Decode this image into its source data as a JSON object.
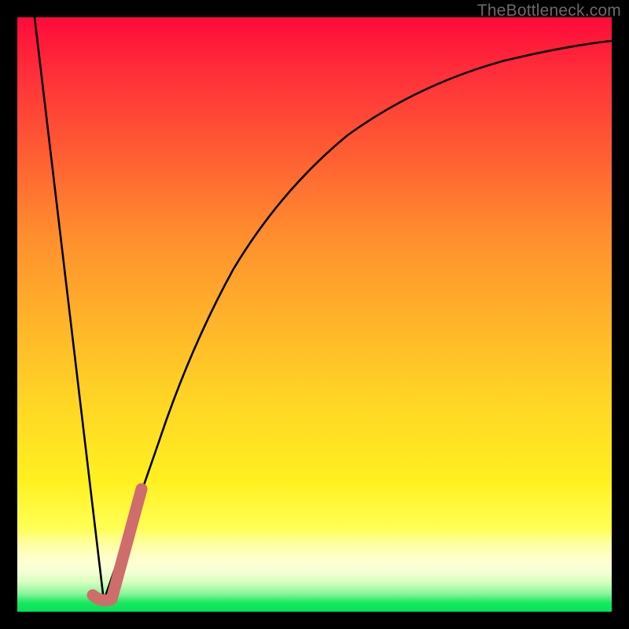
{
  "watermark": {
    "text": "TheBottleneck.com"
  },
  "chart_data": {
    "type": "line",
    "title": "",
    "xlabel": "",
    "ylabel": "",
    "xlim": [
      0,
      100
    ],
    "ylim": [
      0,
      100
    ],
    "grid": false,
    "legend": false,
    "series": [
      {
        "name": "left-descent",
        "stroke": "#000000",
        "values_xy": [
          [
            3,
            100
          ],
          [
            14.5,
            2
          ]
        ]
      },
      {
        "name": "right-curve",
        "stroke": "#000000",
        "values_xy": [
          [
            14.5,
            2
          ],
          [
            18,
            12
          ],
          [
            22,
            25
          ],
          [
            27,
            40
          ],
          [
            33,
            55
          ],
          [
            40,
            67
          ],
          [
            48,
            76
          ],
          [
            57,
            83
          ],
          [
            67,
            88
          ],
          [
            78,
            91.5
          ],
          [
            90,
            94
          ],
          [
            100,
            95.5
          ]
        ]
      },
      {
        "name": "hook-overlay",
        "stroke": "#d06a6a",
        "values_xy": [
          [
            12.5,
            3
          ],
          [
            15.8,
            2.2
          ],
          [
            20.5,
            20
          ]
        ]
      }
    ],
    "background_gradient_stops": [
      {
        "pct": 0,
        "color": "#ff0a3a"
      },
      {
        "pct": 50,
        "color": "#ffb12a"
      },
      {
        "pct": 86,
        "color": "#ffff55"
      },
      {
        "pct": 100,
        "color": "#00e45a"
      }
    ]
  }
}
